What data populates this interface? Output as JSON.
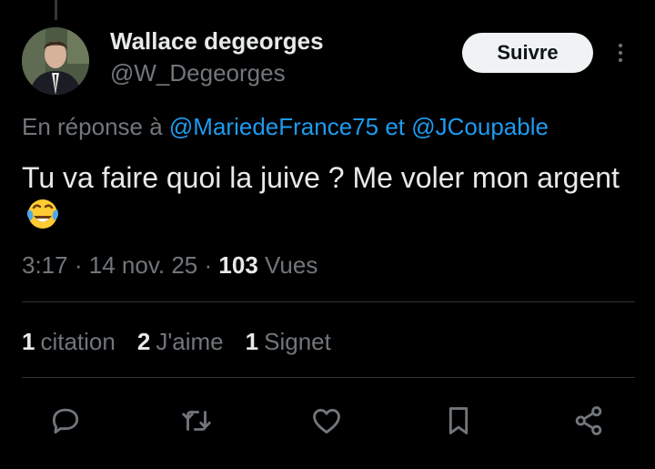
{
  "author": {
    "name": "Wallace degeorges",
    "handle": "@W_Degeorges"
  },
  "follow_label": "Suivre",
  "reply_context": {
    "prefix": "En réponse à",
    "mention_1": "@MariedeFrance75",
    "conjunction": "et",
    "mention_2": "@JCoupable"
  },
  "tweet": {
    "text": "Tu va faire quoi la juive ? Me voler mon argent",
    "emoji": "face-with-tears-of-joy"
  },
  "meta": {
    "time": "3:17",
    "separator": "·",
    "date": "14 nov. 25",
    "views_count": "103",
    "views_label": "Vues"
  },
  "stats": {
    "quotes_count": "1",
    "quotes_label": "citation",
    "likes_count": "2",
    "likes_label": "J'aime",
    "bookmarks_count": "1",
    "bookmarks_label": "Signet"
  },
  "icons": {
    "reply": "reply-icon",
    "retweet": "retweet-icon",
    "like": "heart-icon",
    "bookmark": "bookmark-icon",
    "share": "share-icon",
    "more": "more-icon"
  },
  "colors": {
    "background": "#000000",
    "text": "#e7e9ea",
    "muted": "#71767b",
    "link": "#1d9bf0",
    "divider": "#2f3336",
    "button_bg": "#eff3f4"
  }
}
